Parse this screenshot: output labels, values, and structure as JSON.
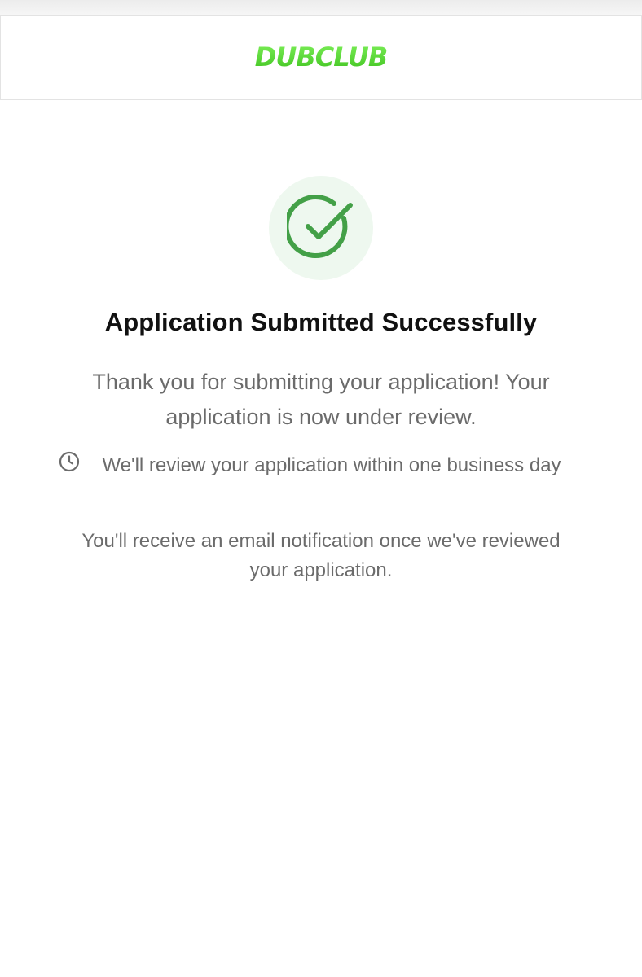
{
  "brand": {
    "logo_text": "DUBCLUB",
    "accent": "#5ee03a",
    "accent_dark": "#3cb81f"
  },
  "status": {
    "icon": "check-circle-icon",
    "icon_color": "#43a047",
    "icon_bg": "#eef8ef"
  },
  "title": "Application Submitted Successfully",
  "message": "Thank you for submitting your application! Your application is now under review.",
  "review": {
    "icon": "clock-icon",
    "text": "We'll review your application within one business day"
  },
  "email_note": "You'll receive an email notification once we've reviewed your application."
}
